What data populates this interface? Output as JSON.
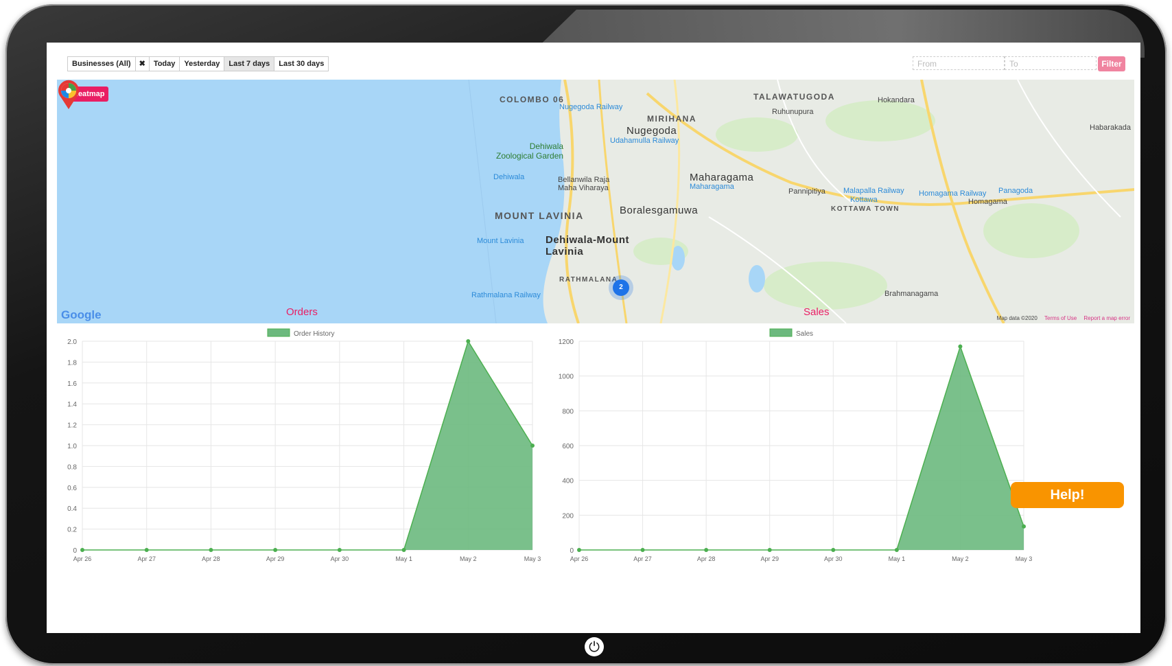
{
  "toolbar": {
    "businesses": "Businesses (All)",
    "clear": "✖",
    "ranges": [
      "Today",
      "Yesterday",
      "Last 7 days",
      "Last 30 days"
    ],
    "active_range": "Last 7 days",
    "from_placeholder": "From",
    "to_placeholder": "To",
    "filter_label": "Filter"
  },
  "map": {
    "heatmap_label": "Heatmap",
    "labels": {
      "colombo": "COLOMBO 06",
      "nugegoda_rail": "Nugegoda Railway",
      "mirihana": "MIRIHANA",
      "talawatugoda": "TALAWATUGODA",
      "hokandara": "Hokandara",
      "ruhunupura": "Ruhunupura",
      "nugegoda": "Nugegoda",
      "udahamulla": "Udahamulla Railway",
      "habarakada": "Habarakada",
      "zoo": "Dehiwala\nZoological Garden",
      "dehiwala": "Dehiwala",
      "maharagama": "Maharagama",
      "maharagama_rail": "Maharagama",
      "bellanwila": "Bellanwila Raja\nMaha Viharaya",
      "pannipitiya": "Pannipitiya",
      "malapalla": "Malapalla Railway",
      "kottawa": "Kottawa",
      "kottawa_town": "KOTTAWA TOWN",
      "homagama_rail": "Homagama Railway",
      "panagoda": "Panagoda",
      "homagama": "Homagama",
      "mount_lavinia_caps": "MOUNT LAVINIA",
      "boralesgamuwa": "Boralesgamuwa",
      "mount_lavinia": "Mount Lavinia",
      "dehiwala_mount": "Dehiwala-Mount\nLavinia",
      "rathmalana": "RATHMALANA",
      "rathmalana_rail": "Rathmalana Railway",
      "brahmanagama": "Brahmanagama"
    },
    "cluster_count": "2",
    "google": "Google",
    "map_data": "Map data ©2020",
    "terms": "Terms of Use",
    "report": "Report a map error"
  },
  "charts": {
    "color_fill": "#6cb97e",
    "color_line": "#4caf50"
  },
  "chart_data": [
    {
      "type": "area",
      "title": "Orders",
      "x": [
        "Apr 26",
        "Apr 27",
        "Apr 28",
        "Apr 29",
        "Apr 30",
        "May 1",
        "May 2",
        "May 3"
      ],
      "series": [
        {
          "name": "Order History",
          "values": [
            0,
            0,
            0,
            0,
            0,
            0,
            2,
            1
          ]
        }
      ],
      "ylim": [
        0,
        2
      ],
      "yticks": [
        "2.0",
        "1.8",
        "1.6",
        "1.4",
        "1.2",
        "1.0",
        "0.8",
        "0.6",
        "0.4",
        "0.2",
        "0"
      ],
      "legend": "top",
      "grid": true
    },
    {
      "type": "area",
      "title": "Sales",
      "x": [
        "Apr 26",
        "Apr 27",
        "Apr 28",
        "Apr 29",
        "Apr 30",
        "May 1",
        "May 2",
        "May 3"
      ],
      "series": [
        {
          "name": "Sales",
          "values": [
            0,
            0,
            0,
            0,
            0,
            0,
            1170,
            135
          ]
        }
      ],
      "ylim": [
        0,
        1200
      ],
      "yticks": [
        "1200",
        "1000",
        "800",
        "600",
        "400",
        "200",
        "0"
      ],
      "legend": "top",
      "grid": true
    }
  ],
  "help_label": "Help!",
  "power_icon": "⏻"
}
